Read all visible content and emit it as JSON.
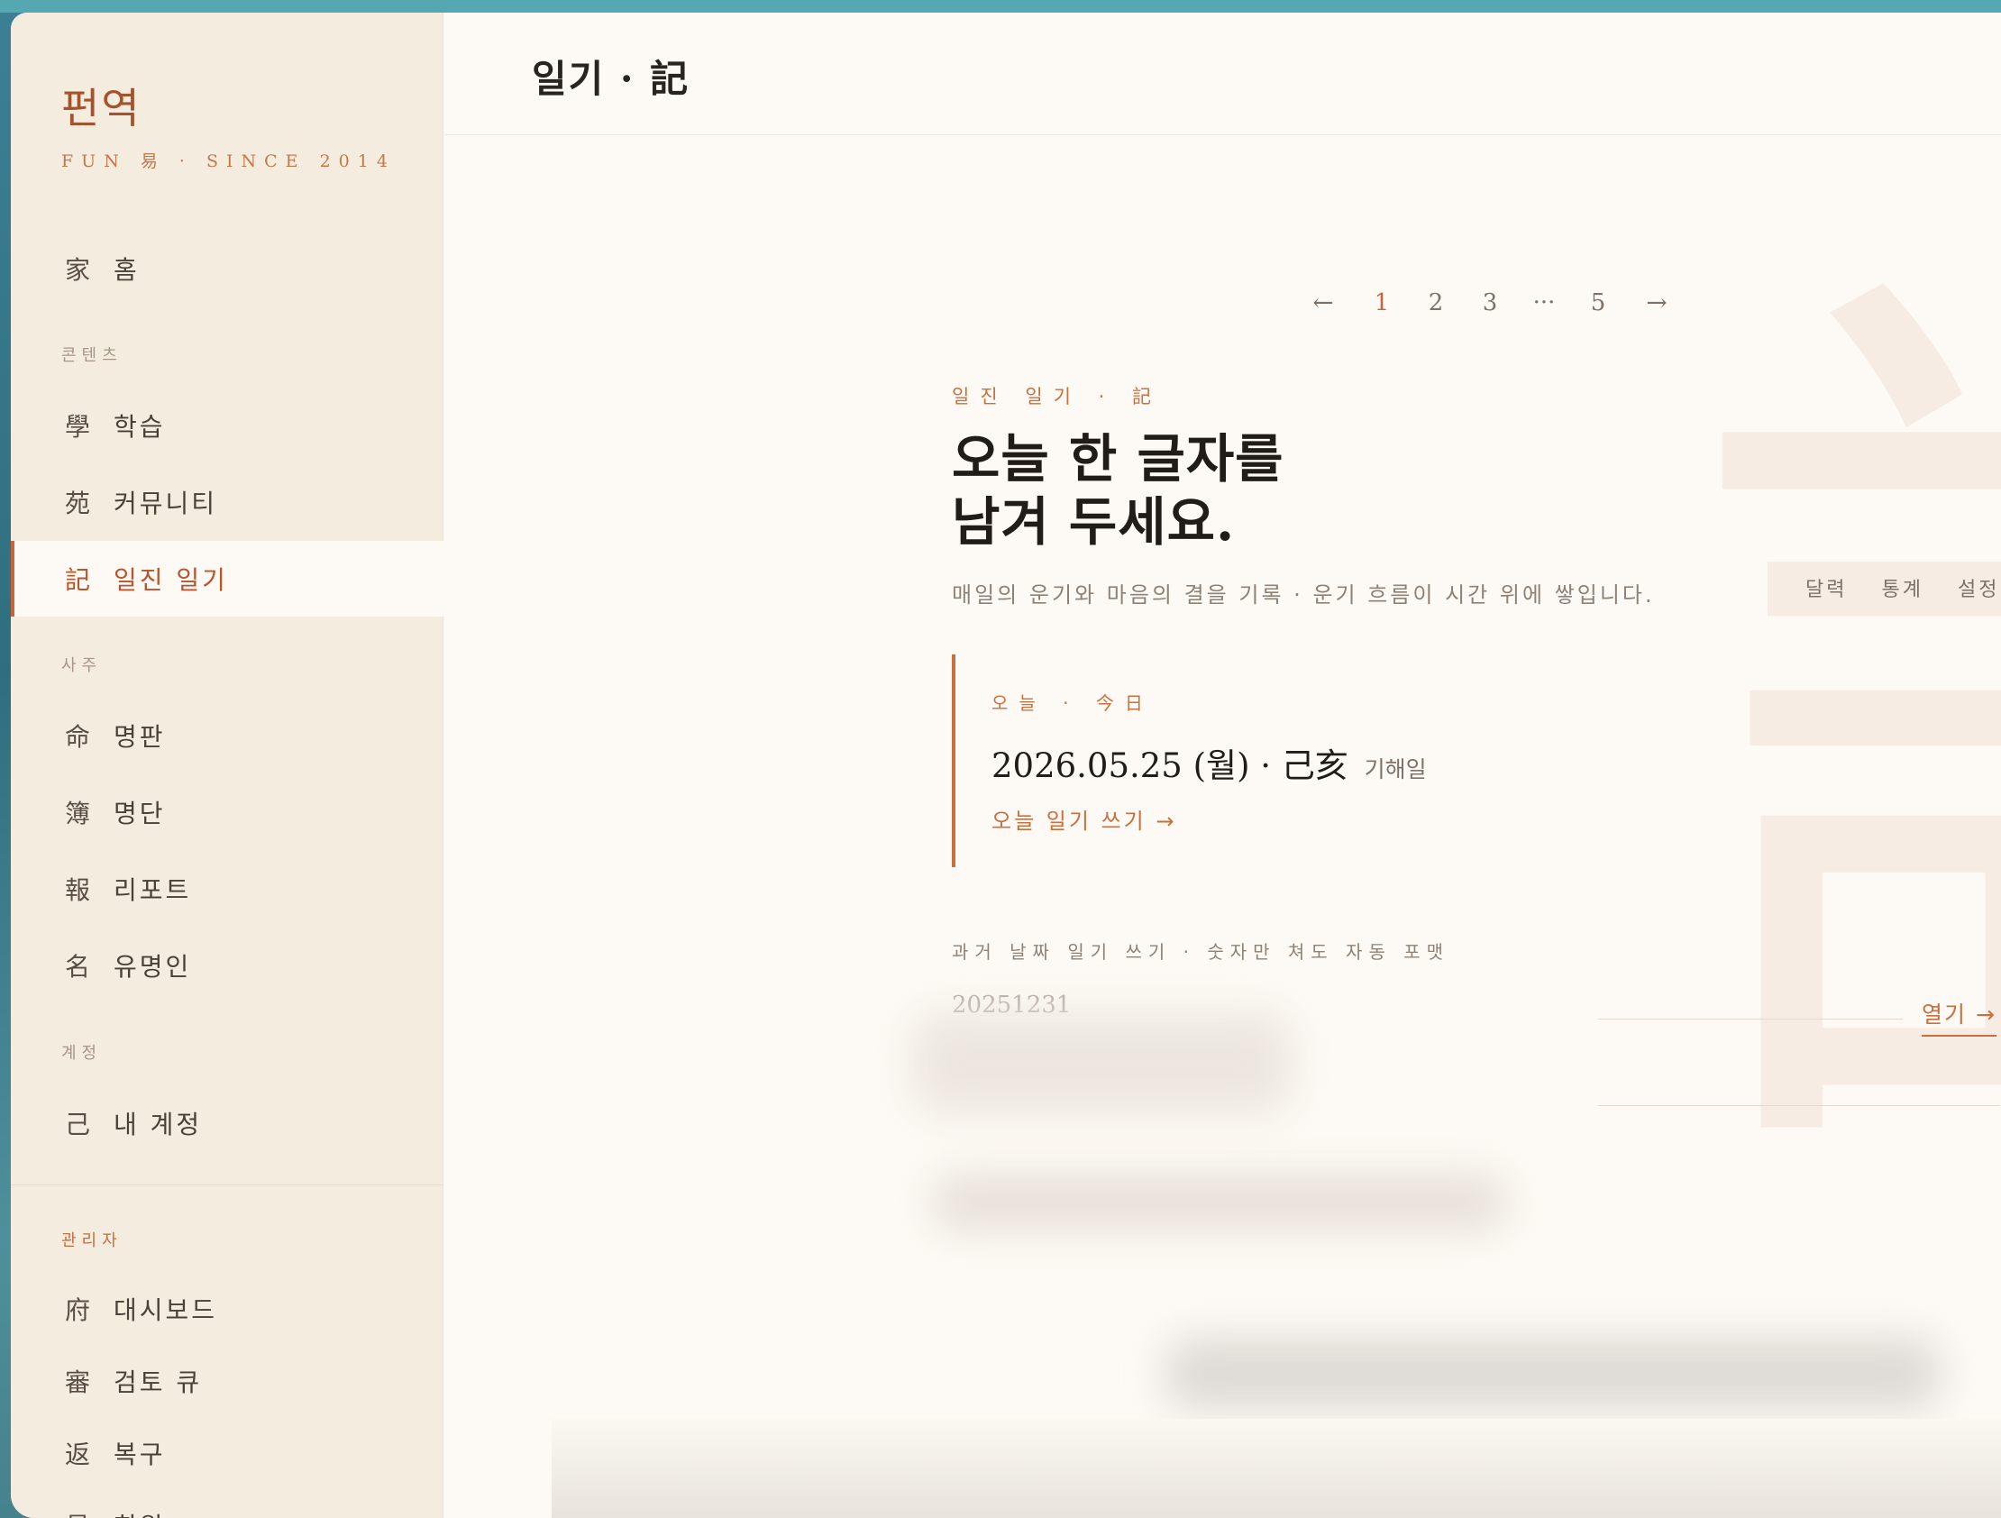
{
  "brand": {
    "name": "펀역",
    "subtitle": "FUN 易 · SINCE 2014"
  },
  "sidebar": {
    "home": {
      "hanja": "家",
      "label": "홈"
    },
    "sections": {
      "contents": "콘텐츠",
      "saju": "사주",
      "account": "계정",
      "admin": "관리자"
    },
    "contents_items": [
      {
        "hanja": "學",
        "label": "학습"
      },
      {
        "hanja": "苑",
        "label": "커뮤니티"
      },
      {
        "hanja": "記",
        "label": "일진 일기",
        "active": true
      }
    ],
    "saju_items": [
      {
        "hanja": "命",
        "label": "명판"
      },
      {
        "hanja": "簿",
        "label": "명단"
      },
      {
        "hanja": "報",
        "label": "리포트"
      },
      {
        "hanja": "名",
        "label": "유명인"
      }
    ],
    "account_items": [
      {
        "hanja": "己",
        "label": "내 계정"
      }
    ],
    "admin_items": [
      {
        "hanja": "府",
        "label": "대시보드"
      },
      {
        "hanja": "審",
        "label": "검토 큐"
      },
      {
        "hanja": "返",
        "label": "복구"
      },
      {
        "hanja": "員",
        "label": "회원"
      }
    ]
  },
  "header": {
    "title": "일기 · 記"
  },
  "watermark": "記",
  "pager": {
    "prev": "←",
    "pages": [
      "1",
      "2",
      "3",
      "···",
      "5"
    ],
    "current": "1",
    "next": "→"
  },
  "hero": {
    "eyebrow": "일진 일기 · 記",
    "headline_line1": "오늘 한 글자를",
    "headline_line2": "남겨 두세요.",
    "lede": "매일의 운기와 마음의 결을 기록 · 운기 흐름이 시간 위에 쌓입니다."
  },
  "subnav": [
    "달력",
    "통계",
    "설정"
  ],
  "today": {
    "label": "오늘 · 今日",
    "date": "2026.05.25 (월) · 己亥",
    "ganji_day": "기해일",
    "cta": "오늘 일기 쓰기 →"
  },
  "past": {
    "label": "과거 날짜 일기 쓰기 · 숫자만 쳐도 자동 포맷",
    "placeholder": "20251231",
    "open": "열기 →"
  },
  "colors": {
    "accent": "#c8703e",
    "brand": "#a4542c",
    "sidebar_bg": "#f5ece0",
    "main_bg": "#fdf9f4"
  }
}
